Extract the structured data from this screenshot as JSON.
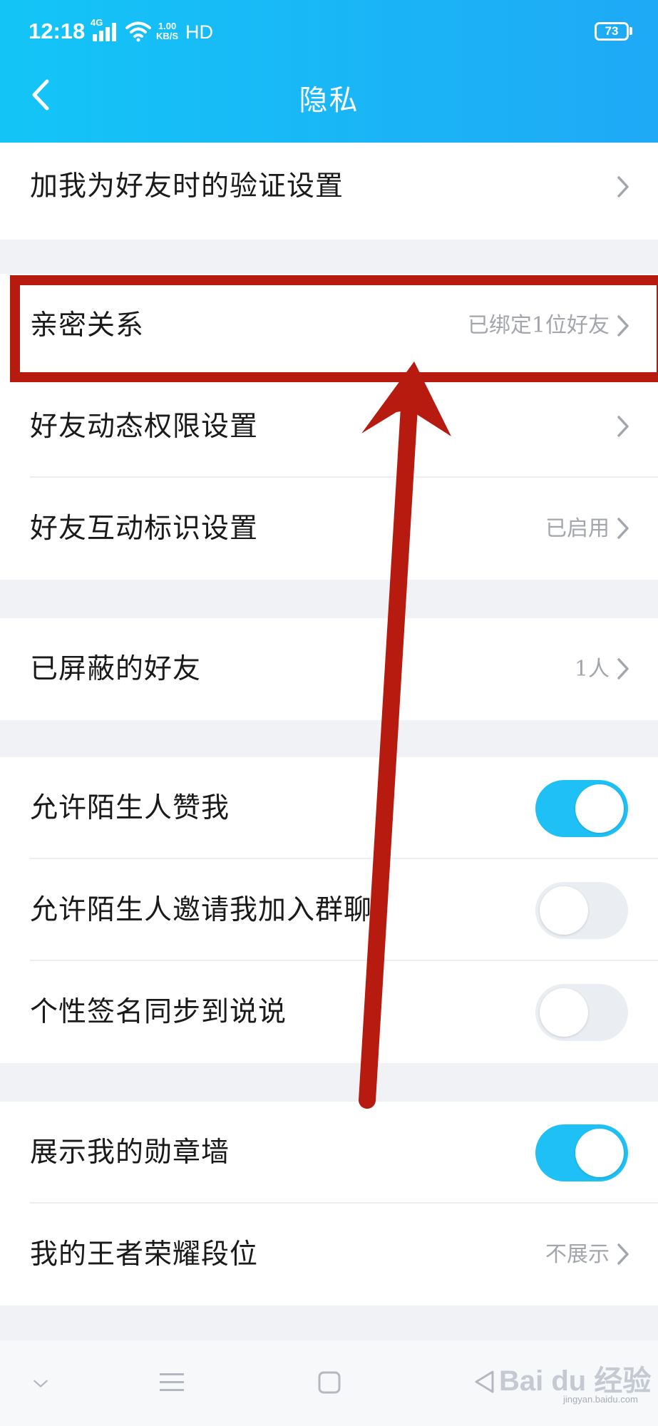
{
  "status_bar": {
    "time": "12:18",
    "network": "4G",
    "speed_value": "1.00",
    "speed_unit": "KB/S",
    "hd": "HD",
    "battery": "73"
  },
  "header": {
    "title": "隐私"
  },
  "groups": [
    {
      "rows": [
        {
          "label": "加我为好友时的验证设置",
          "value": ""
        }
      ]
    },
    {
      "rows": [
        {
          "label": "亲密关系",
          "value": "已绑定1位好友"
        },
        {
          "label": "好友动态权限设置",
          "value": ""
        },
        {
          "label": "好友互动标识设置",
          "value": "已启用"
        }
      ]
    },
    {
      "rows": [
        {
          "label": "已屏蔽的好友",
          "value": "1人"
        }
      ]
    },
    {
      "rows": [
        {
          "label": "允许陌生人赞我",
          "toggle": true
        },
        {
          "label": "允许陌生人邀请我加入群聊",
          "toggle": false
        },
        {
          "label": "个性签名同步到说说",
          "toggle": false
        }
      ]
    },
    {
      "rows": [
        {
          "label": "展示我的勋章墙",
          "toggle": true
        },
        {
          "label": "我的王者荣耀段位",
          "value": "不展示"
        }
      ]
    }
  ],
  "watermark": {
    "text": "Bai du 经验",
    "sub": "jingyan.baidu.com"
  },
  "colors": {
    "header_start": "#13c5f7",
    "header_end": "#1fa9f6",
    "toggle_on": "#1ec0f6",
    "toggle_off": "#eaedf2",
    "annotation": "#b71b10"
  }
}
